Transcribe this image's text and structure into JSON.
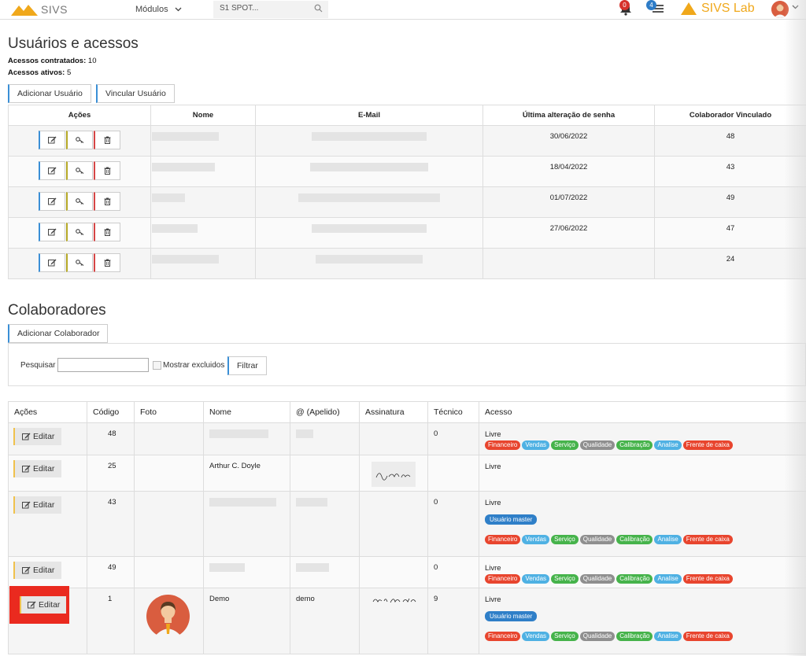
{
  "topbar": {
    "app_name": "SIVS",
    "modules_label": "Módulos",
    "search_value": "S1 SPOT...",
    "bell_count": "0",
    "list_count": "4",
    "brand_name": "SIVS Lab",
    "colors": {
      "brand": "#f0a81b",
      "bell_badge": "#d6322b",
      "list_badge": "#2e7cc7"
    }
  },
  "users_section": {
    "title": "Usuários e acessos",
    "contracted_label": "Acessos contratados:",
    "contracted_value": "10",
    "active_label": "Acessos ativos:",
    "active_value": "5",
    "add_user_label": "Adicionar Usuário",
    "link_user_label": "Vincular Usuário",
    "columns": [
      "Ações",
      "Nome",
      "E-Mail",
      "Última alteração de senha",
      "Colaborador Vinculado"
    ],
    "rows": [
      {
        "password_changed": "30/06/2022",
        "collaborator": "48"
      },
      {
        "password_changed": "18/04/2022",
        "collaborator": "43"
      },
      {
        "password_changed": "01/07/2022",
        "collaborator": "49"
      },
      {
        "password_changed": "27/06/2022",
        "collaborator": "47"
      },
      {
        "password_changed": "",
        "collaborator": "24"
      }
    ]
  },
  "collab_section": {
    "title": "Colaboradores",
    "add_label": "Adicionar Colaborador",
    "filter": {
      "search_label": "Pesquisar",
      "search_value": "",
      "show_deleted_label": "Mostrar excluidos",
      "filter_button": "Filtrar"
    },
    "columns": [
      "Ações",
      "Código",
      "Foto",
      "Nome",
      "@ (Apelido)",
      "Assinatura",
      "Técnico",
      "Acesso"
    ],
    "edit_label": "Editar",
    "rows": [
      {
        "code": "48",
        "name": "",
        "nick": "",
        "tech": "0",
        "access": "Livre",
        "master": "",
        "tags": true
      },
      {
        "code": "25",
        "name": "Arthur C. Doyle",
        "nick": "",
        "tech": "",
        "access": "Livre",
        "master": "",
        "tags": false
      },
      {
        "code": "43",
        "name": "",
        "nick": "",
        "tech": "0",
        "access": "Livre",
        "master": "Usuário master",
        "tags": true
      },
      {
        "code": "49",
        "name": "",
        "nick": "",
        "tech": "0",
        "access": "Livre",
        "master": "",
        "tags": true
      },
      {
        "code": "1",
        "name": "Demo",
        "nick": "demo",
        "tech": "9",
        "access": "Livre",
        "master": "Usuário master",
        "tags": true
      }
    ],
    "tags": [
      {
        "label": "Financeiro",
        "color": "#e8452e"
      },
      {
        "label": "Vendas",
        "color": "#4fb1e3"
      },
      {
        "label": "Serviço",
        "color": "#46b34b"
      },
      {
        "label": "Qualidade",
        "color": "#8f8f8f"
      },
      {
        "label": "Calibração",
        "color": "#46b34b"
      },
      {
        "label": "Analise",
        "color": "#4fb1e3"
      },
      {
        "label": "Frente de caixa",
        "color": "#e8452e"
      }
    ]
  }
}
